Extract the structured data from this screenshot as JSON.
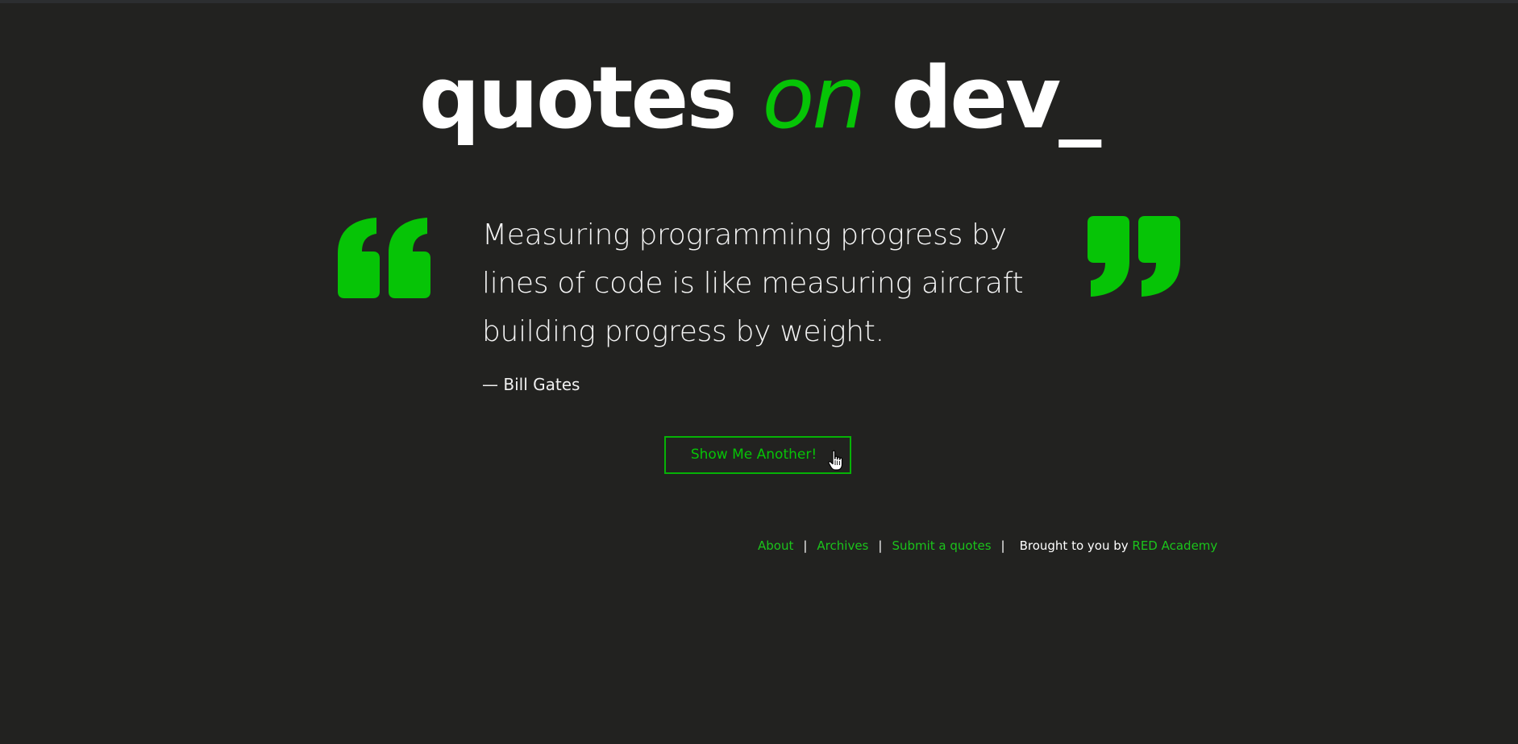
{
  "logo": {
    "word1": "quotes ",
    "word2": "on",
    "word3": " dev_"
  },
  "quote": {
    "text": "Measuring programming progress by lines of code is like measuring aircraft building progress by weight.",
    "author": "— Bill Gates"
  },
  "button": {
    "label": "Show Me Another!"
  },
  "footer": {
    "about": "About",
    "archives": "Archives",
    "submit": "Submit a quotes",
    "credit_prefix": "Brought to you by ",
    "credit_link": "RED Academy",
    "separator": "|"
  },
  "colors": {
    "accent": "#06c406",
    "background": "#222220",
    "text": "#ffffff"
  },
  "icons": {
    "open_quote": "open-quote-icon",
    "close_quote": "close-quote-icon",
    "cursor": "hand-pointer-cursor-icon"
  }
}
